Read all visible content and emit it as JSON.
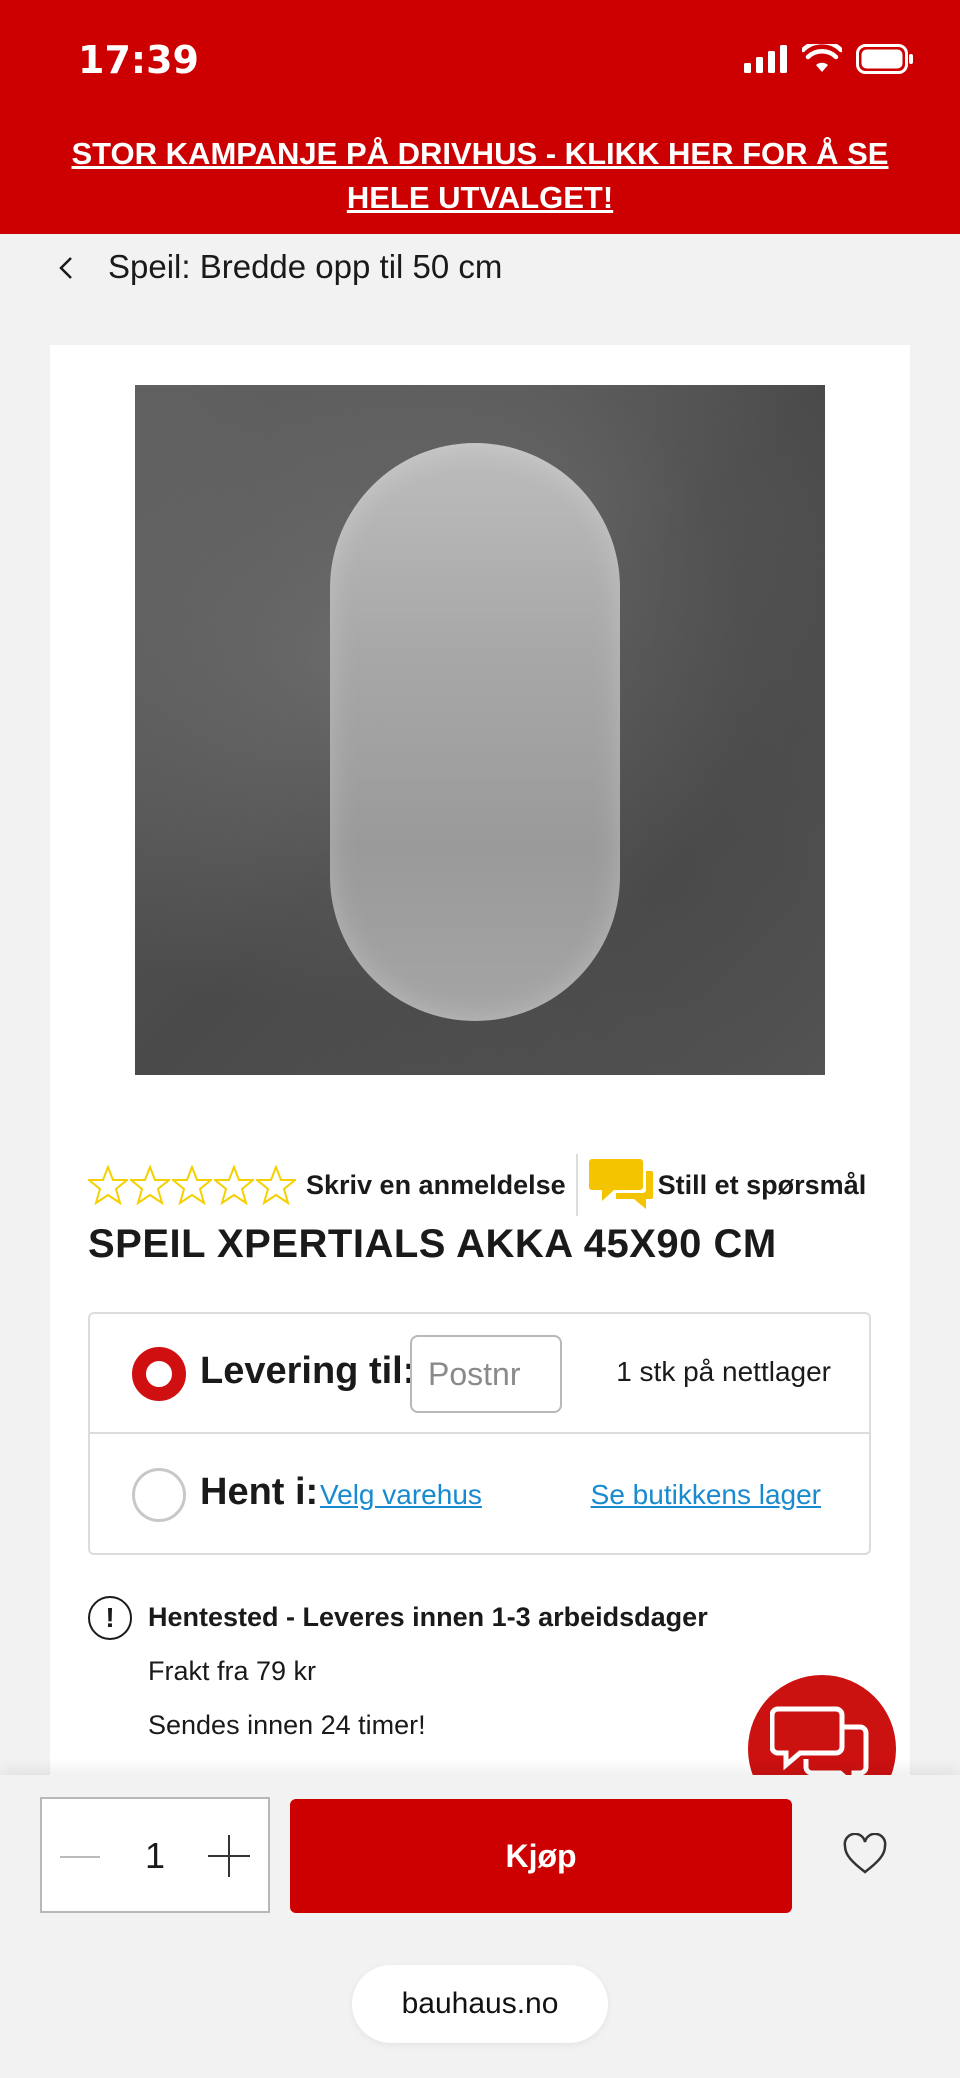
{
  "status_bar": {
    "time": "17:39"
  },
  "promo_banner": {
    "text": "STOR KAMPANJE PÅ DRIVHUS - KLIKK HER FOR Å SE HELE UTVALGET!"
  },
  "breadcrumb": {
    "label": "Speil: Bredde opp til 50 cm"
  },
  "product": {
    "review_link": "Skriv en anmeldelse",
    "question_link": "Still et spørsmål",
    "rating_stars": 0,
    "title": "SPEIL XPERTIALS AKKA 45X90 CM"
  },
  "delivery": {
    "option_delivery_label": "Levering til:",
    "postnr_placeholder": "Postnr",
    "stock_text": "1 stk på nettlager",
    "option_pickup_label": "Hent i:",
    "choose_store_link": "Velg varehus",
    "store_stock_link": "Se butikkens lager"
  },
  "info": {
    "title": "Hentested - Leveres innen 1-3 arbeidsdager",
    "shipping": "Frakt fra 79 kr",
    "dispatch": "Sendes innen 24 timer!"
  },
  "cart": {
    "quantity": "1",
    "buy_label": "Kjøp"
  },
  "browser": {
    "url": "bauhaus.no"
  },
  "colors": {
    "brand_red": "#cc0000",
    "link_blue": "#1a8ad0",
    "star_yellow": "#f5d000"
  }
}
